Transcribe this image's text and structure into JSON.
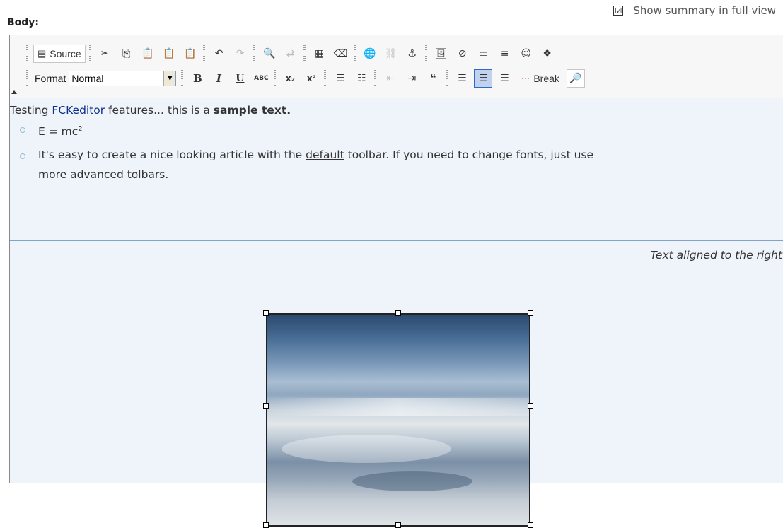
{
  "field": {
    "label": "Body:"
  },
  "summary": {
    "label": "Show summary in full view",
    "checked": "☑"
  },
  "toolbar": {
    "row1": {
      "source_label": "Source",
      "icons": [
        "cut-icon",
        "copy-icon",
        "paste-icon",
        "paste-text-icon",
        "paste-word-icon",
        "undo-icon",
        "redo-icon",
        "find-icon",
        "replace-icon",
        "select-all-icon",
        "remove-format-icon",
        "link-icon",
        "unlink-icon",
        "anchor-icon",
        "image-icon",
        "flash-icon",
        "table-icon",
        "horizontal-rule-icon",
        "smiley-icon",
        "special-char-icon"
      ]
    },
    "row2": {
      "format_label": "Format",
      "format_value": "Normal",
      "break_label": "Break"
    }
  },
  "content": {
    "para_prefix": "Testing ",
    "para_link": "FCKeditor",
    "para_middle": " features... this is a ",
    "para_bold": "sample text.",
    "list": {
      "item1_text": "E = mc",
      "item1_sup": "2",
      "item2_prefix": "It's easy to create a nice looking article with the ",
      "item2_link": "default",
      "item2_suffix": " toolbar. If you need to change fonts, just use",
      "item2_line2": "more advanced tolbars."
    },
    "right_text": "Text aligned to the right"
  }
}
